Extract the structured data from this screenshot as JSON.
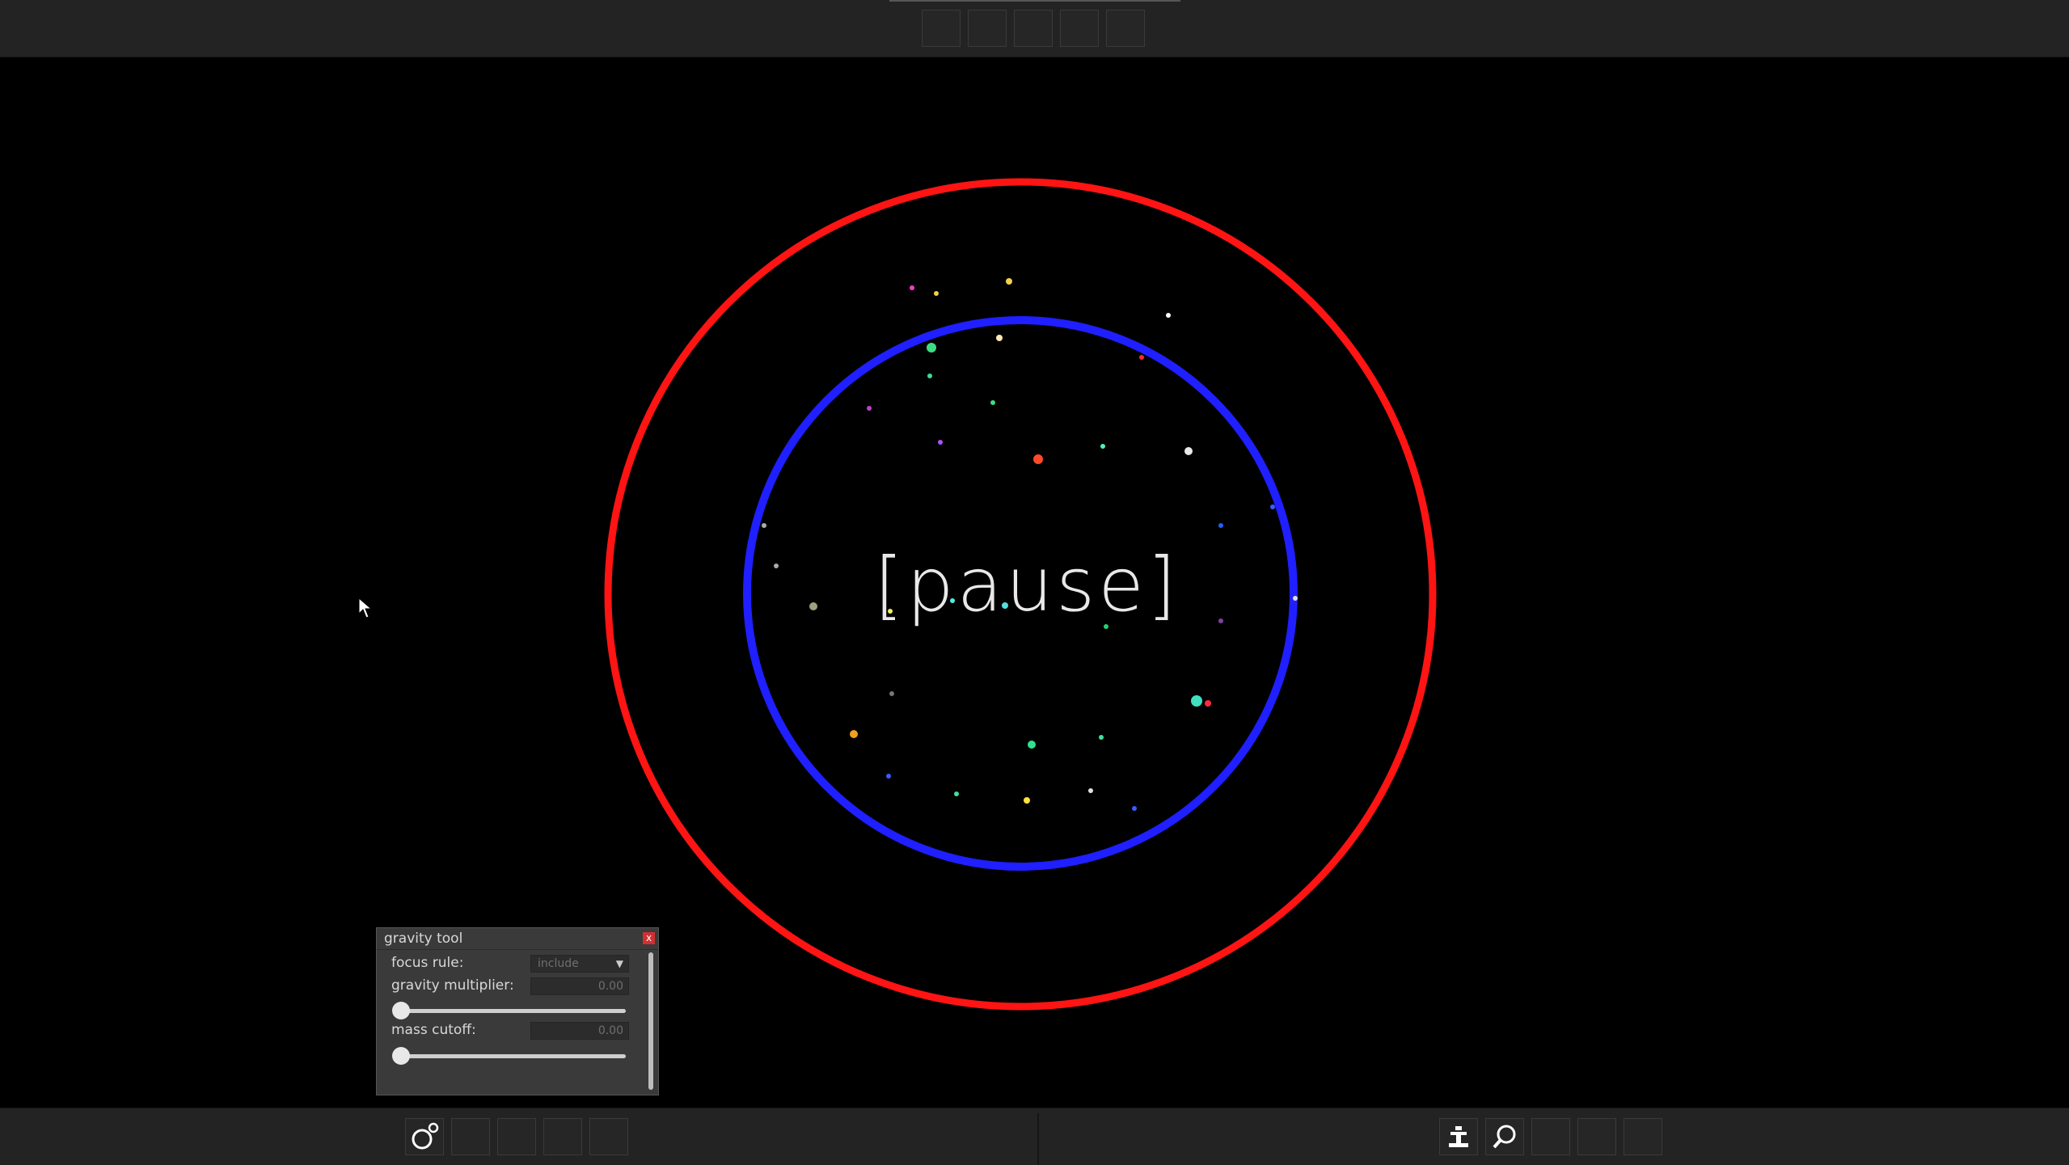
{
  "overlay": {
    "pause_text": "[pause]"
  },
  "colors": {
    "outer_ring": "#ff1414",
    "inner_ring": "#1f1fff",
    "background": "#000000",
    "toolbar": "#232323"
  },
  "top_toolbar": {
    "slot_count": 5
  },
  "bottom_toolbar": {
    "left_icons": [
      "gravity-tool-icon",
      "empty",
      "empty",
      "empty",
      "empty"
    ],
    "right_icons": [
      "inspect-tool-icon",
      "search-icon",
      "empty",
      "empty",
      "empty"
    ]
  },
  "gravity_tool": {
    "title": "gravity tool",
    "close_label": "x",
    "focus_rule": {
      "label": "focus rule:",
      "value": "include"
    },
    "gravity_multiplier": {
      "label": "gravity multiplier:",
      "value": "0.00",
      "slider_fraction": 0
    },
    "mass_cutoff": {
      "label": "mass cutoff:",
      "value": "0.00",
      "slider_fraction": 0
    }
  }
}
